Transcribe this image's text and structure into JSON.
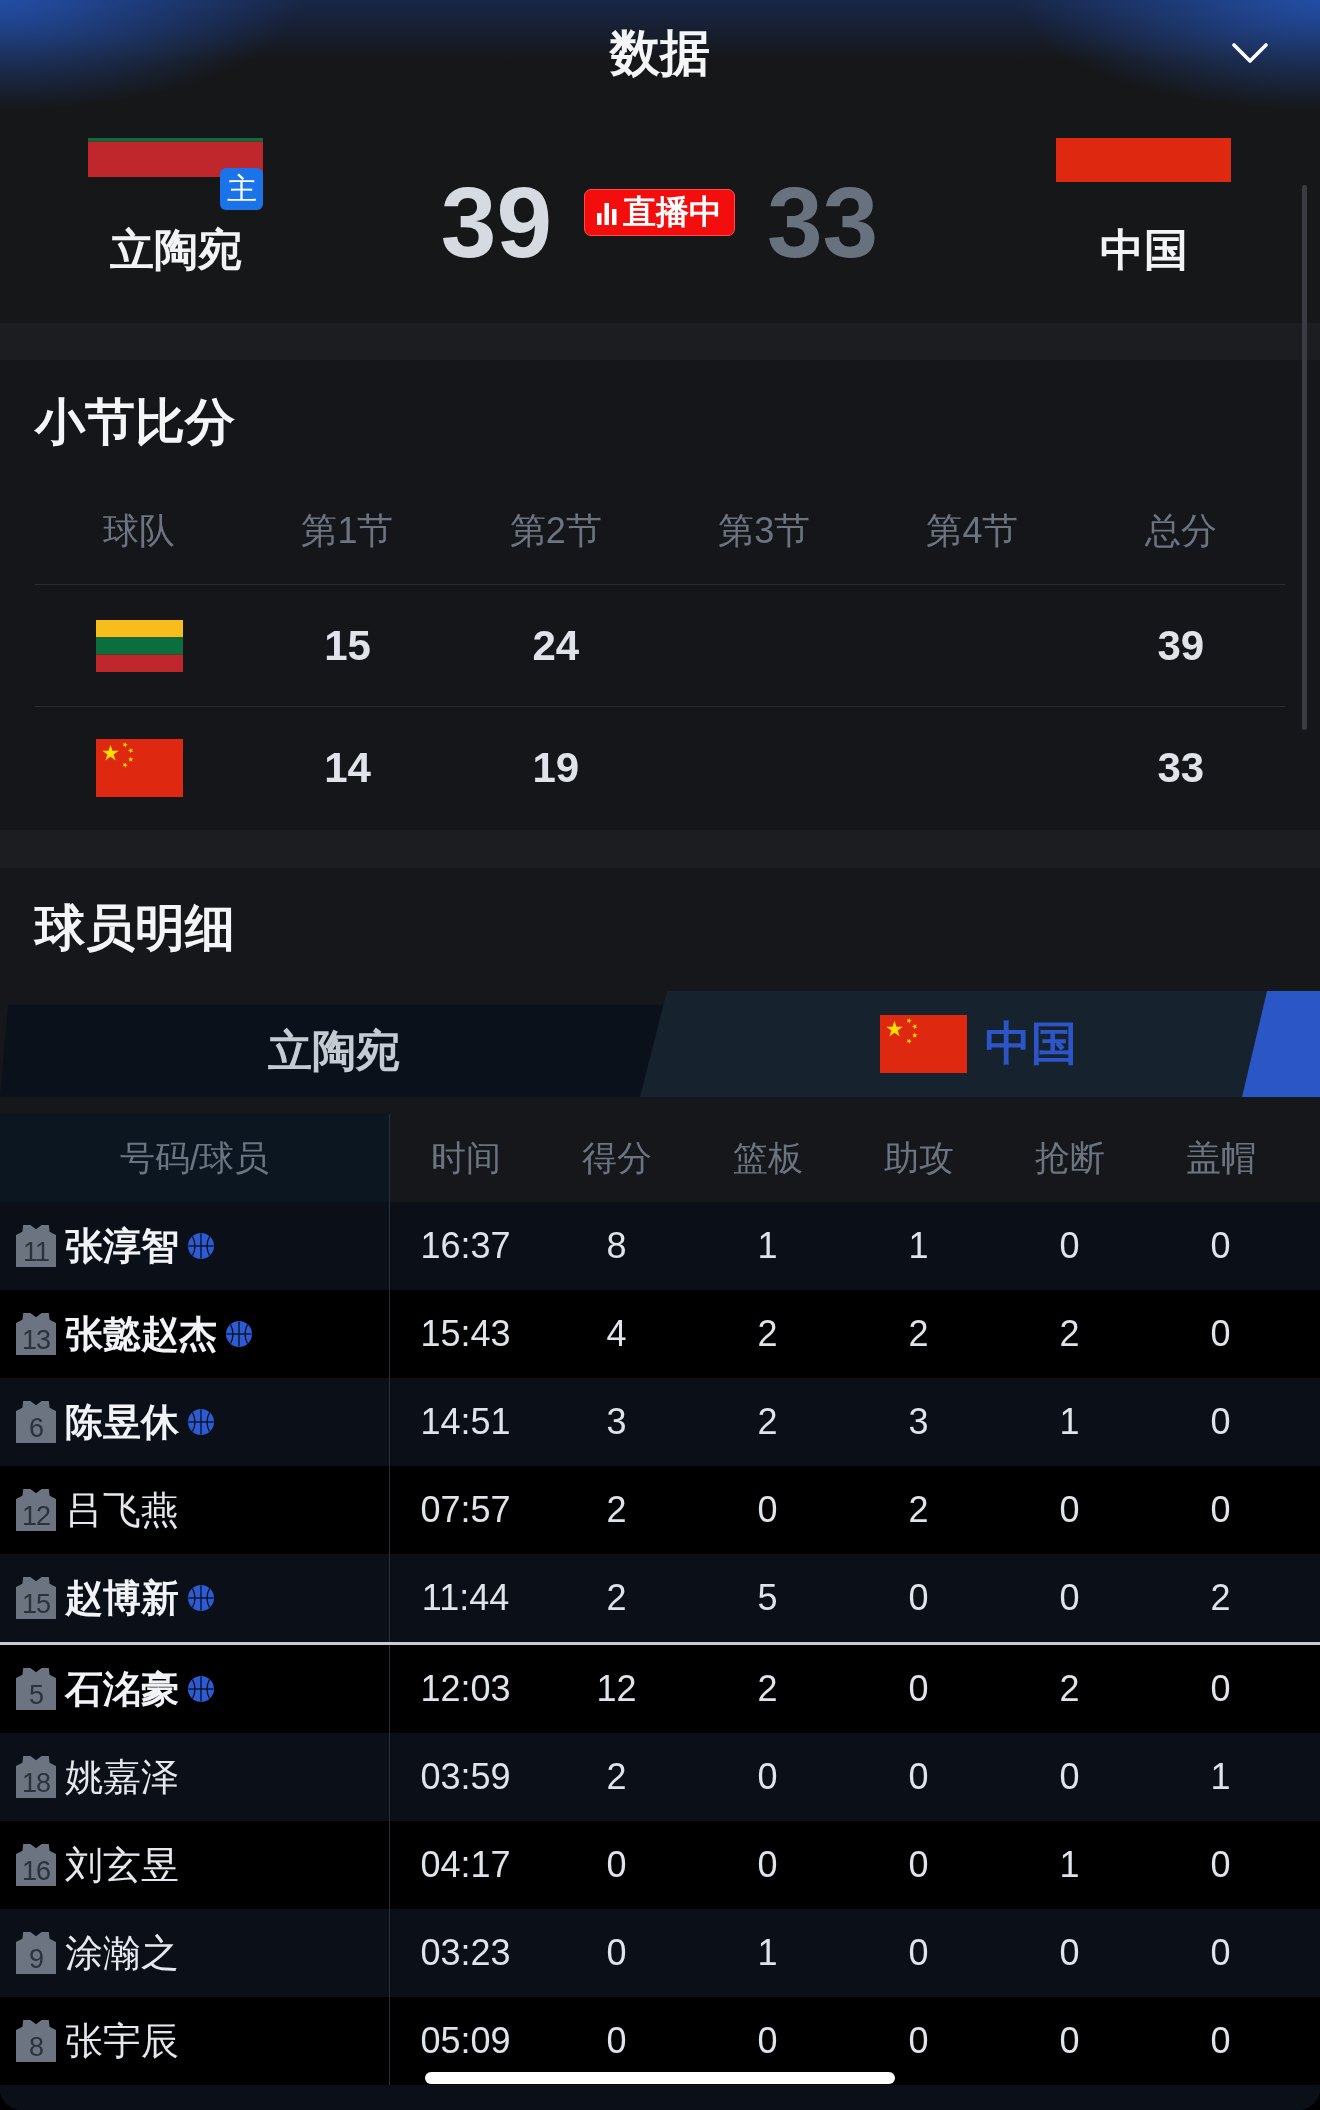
{
  "header": {
    "title": "数据"
  },
  "scoreboard": {
    "home": {
      "name": "立陶宛",
      "flag": {
        "kind": "lithuania"
      },
      "badge": "主",
      "score": "39",
      "leading": true
    },
    "live_badge": "直播中",
    "away": {
      "name": "中国",
      "flag": {
        "kind": "china"
      },
      "score": "33",
      "leading": false
    }
  },
  "quarter_scores": {
    "title": "小节比分",
    "columns": [
      "球队",
      "第1节",
      "第2节",
      "第3节",
      "第4节",
      "总分"
    ],
    "rows": [
      {
        "flag": {
          "kind": "lithuania"
        },
        "periods": [
          "15",
          "24"
        ],
        "total": "39"
      },
      {
        "flag": {
          "kind": "china"
        },
        "periods": [
          "14",
          "19"
        ],
        "total": "33"
      }
    ]
  },
  "player_detail": {
    "title": "球员明细",
    "tabs": [
      {
        "label": "立陶宛",
        "selected": false
      },
      {
        "label": "中国",
        "flag": {
          "kind": "china"
        },
        "selected": true
      }
    ],
    "columns": [
      "号码/球员",
      "时间",
      "得分",
      "篮板",
      "助攻",
      "抢断",
      "盖帽"
    ],
    "starters": [
      {
        "number": "11",
        "name": "张淳智",
        "on_court": true,
        "stats": [
          "16:37",
          "8",
          "1",
          "1",
          "0",
          "0"
        ]
      },
      {
        "number": "13",
        "name": "张懿赵杰",
        "on_court": true,
        "stats": [
          "15:43",
          "4",
          "2",
          "2",
          "2",
          "0"
        ]
      },
      {
        "number": "6",
        "name": "陈昱休",
        "on_court": true,
        "stats": [
          "14:51",
          "3",
          "2",
          "3",
          "1",
          "0"
        ]
      },
      {
        "number": "12",
        "name": "吕飞燕",
        "on_court": false,
        "stats": [
          "07:57",
          "2",
          "0",
          "2",
          "0",
          "0"
        ]
      },
      {
        "number": "15",
        "name": "赵博新",
        "on_court": true,
        "stats": [
          "11:44",
          "2",
          "5",
          "0",
          "0",
          "2"
        ]
      }
    ],
    "bench": [
      {
        "number": "5",
        "name": "石洺豪",
        "on_court": true,
        "stats": [
          "12:03",
          "12",
          "2",
          "0",
          "2",
          "0"
        ]
      },
      {
        "number": "18",
        "name": "姚嘉泽",
        "on_court": false,
        "stats": [
          "03:59",
          "2",
          "0",
          "0",
          "0",
          "1"
        ]
      },
      {
        "number": "16",
        "name": "刘玄昱",
        "on_court": false,
        "stats": [
          "04:17",
          "0",
          "0",
          "0",
          "1",
          "0"
        ]
      },
      {
        "number": "9",
        "name": "涂瀚之",
        "on_court": false,
        "stats": [
          "03:23",
          "0",
          "1",
          "0",
          "0",
          "0"
        ]
      },
      {
        "number": "8",
        "name": "张宇辰",
        "on_court": false,
        "stats": [
          "05:09",
          "0",
          "0",
          "0",
          "0",
          "0"
        ]
      }
    ]
  }
}
